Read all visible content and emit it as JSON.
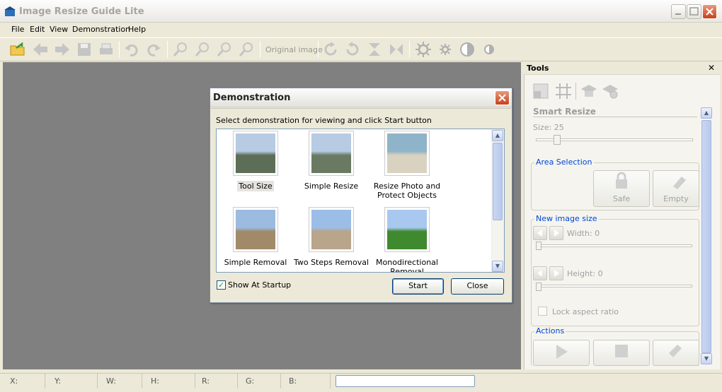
{
  "window": {
    "title": "Image Resize Guide Lite"
  },
  "menu": [
    "File",
    "Edit",
    "View",
    "Demonstration",
    "Help"
  ],
  "toolbar": {
    "original_image_label": "Original image",
    "icons": [
      "open-folder-icon",
      "back-arrow-icon",
      "forward-arrow-icon",
      "save-icon",
      "print-icon",
      "undo-icon",
      "redo-icon",
      "zoom-in-icon",
      "zoom-out-icon",
      "zoom-fit-icon",
      "zoom-actual-icon",
      "rotate-cw-icon",
      "rotate-ccw-icon",
      "flip-vertical-icon",
      "flip-horizontal-icon",
      "brightness-up-icon",
      "brightness-down-icon",
      "contrast-up-icon",
      "contrast-down-icon"
    ]
  },
  "dialog": {
    "title": "Demonstration",
    "instruction": "Select demonstration for viewing and click Start button",
    "items": [
      {
        "label": "Tool Size",
        "selected": true,
        "colors": [
          "#b7cbe3",
          "#5d6e57"
        ]
      },
      {
        "label": "Simple Resize",
        "selected": false,
        "colors": [
          "#b7cbe3",
          "#6a7a62"
        ]
      },
      {
        "label": "Resize Photo and Protect Objects",
        "selected": false,
        "colors": [
          "#8fb3c8",
          "#d9d2c0"
        ]
      },
      {
        "label": "Simple Removal",
        "selected": false,
        "colors": [
          "#9cbbe0",
          "#a08a6a"
        ]
      },
      {
        "label": "Two Steps Removal",
        "selected": false,
        "colors": [
          "#9bbde6",
          "#b8a58a"
        ]
      },
      {
        "label": "Monodirectional Removal",
        "selected": false,
        "colors": [
          "#a8c8f0",
          "#3f8a2e"
        ]
      }
    ],
    "show_at_startup": {
      "label": "Show At Startup",
      "checked": true
    },
    "start_label": "Start",
    "close_label": "Close"
  },
  "tools": {
    "title": "Tools",
    "section_title": "Smart Resize",
    "size_label": "Size: 25",
    "area_selection": {
      "title": "Area Selection",
      "safe_label": "Safe",
      "empty_label": "Empty"
    },
    "new_image_size": {
      "title": "New image size",
      "width_label": "Width: 0",
      "height_label": "Height: 0",
      "lock_label": "Lock aspect ratio"
    },
    "actions": {
      "title": "Actions"
    }
  },
  "status": {
    "x": "X:",
    "y": "Y:",
    "w": "W:",
    "h": "H:",
    "r": "R:",
    "g": "G:",
    "b": "B:"
  }
}
